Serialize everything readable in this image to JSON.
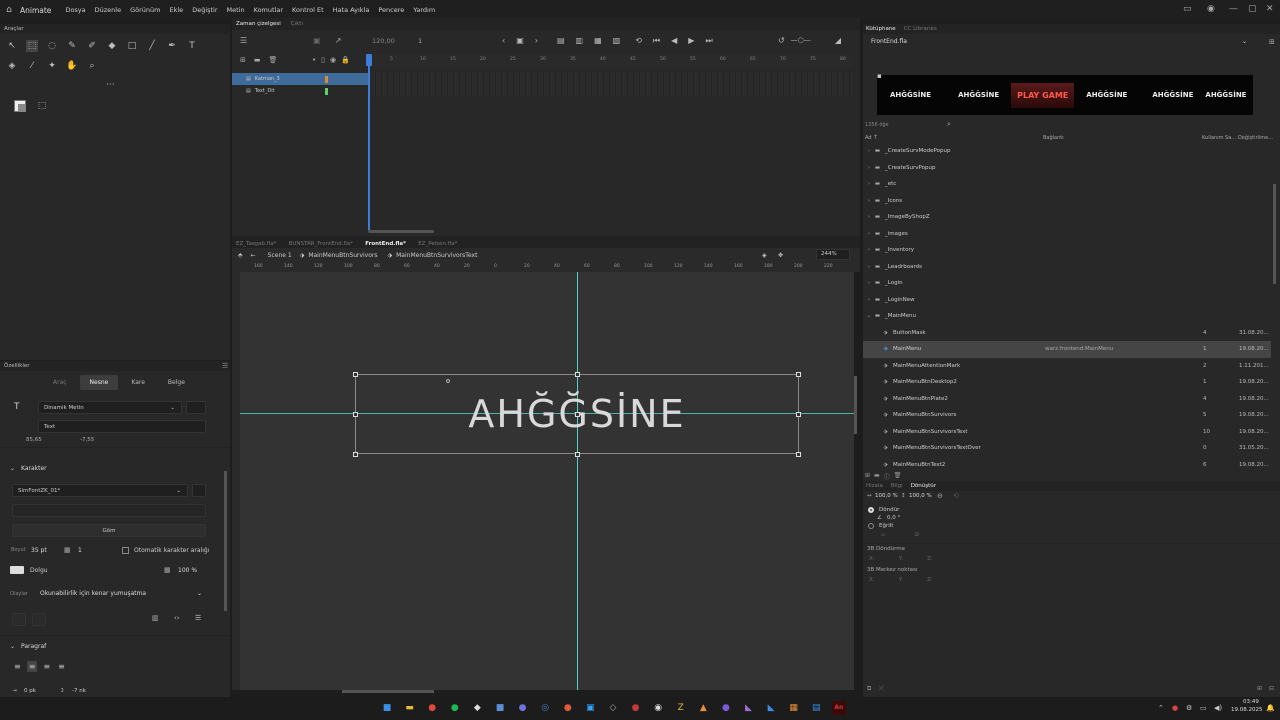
{
  "menubar": {
    "app_name": "Animate",
    "items": [
      "Dosya",
      "Düzenle",
      "Görünüm",
      "Ekle",
      "Değiştir",
      "Metin",
      "Komutlar",
      "Kontrol Et",
      "Hata Ayıkla",
      "Pencere",
      "Yardım"
    ]
  },
  "tools_panel": {
    "title": "Araçlar"
  },
  "timeline": {
    "tabs": [
      "Zaman çizelgesi",
      "Çıktı"
    ],
    "fps": "120,00",
    "frame": "1",
    "layers": [
      {
        "name": "Katman_3",
        "color": "#e0873a"
      },
      {
        "name": "Text_Dit",
        "color": "#5fd35f"
      }
    ],
    "ruler_ticks": [
      "5",
      "10",
      "15",
      "20",
      "25",
      "30",
      "35",
      "40",
      "45",
      "50",
      "55",
      "60",
      "65",
      "70",
      "75",
      "80"
    ]
  },
  "document_tabs": [
    "EZ_Tasgab.fla*",
    "BUNSTAR_FrontEnd.fla*",
    "FrontEnd.fla*",
    "EZ_Pelsen.fla*"
  ],
  "breadcrumb": {
    "scene": "Scene 1",
    "symbol1": "MainMenuBtnSurvivors",
    "symbol2": "MainMenuBtnSurvivorsText",
    "zoom": "244%"
  },
  "stage": {
    "ruler_ticks": [
      "160",
      "140",
      "120",
      "100",
      "80",
      "60",
      "40",
      "20",
      "0",
      "20",
      "40",
      "60",
      "80",
      "100",
      "120",
      "140",
      "160",
      "180",
      "200",
      "220"
    ],
    "text": "AHĞĞSİNE"
  },
  "properties": {
    "title": "Özellikler",
    "tabs": [
      "Araç",
      "Nesne",
      "Kare",
      "Belge"
    ],
    "text_type": "Dinamik Metin",
    "instance_name": "Text",
    "x": "85,65",
    "y": "-7,55",
    "character_section": "Karakter",
    "font": "SimFontZK_01*",
    "embed_button": "Göm",
    "size_label": "Boyut",
    "size_value": "35 pt",
    "letter_spacing": "1",
    "auto_kern_label": "Otomatik karakter aralığı",
    "fill_label": "Dolgu",
    "fill_percent": "100 %",
    "options_label": "Olaylar",
    "antialias": "Okunabilirlik için kenar yumuşatma",
    "paragraph_section": "Paragraf",
    "indent": "0 pk",
    "line_spacing": "-7 nk"
  },
  "library": {
    "tabs": [
      "Kütüphane",
      "CC Libraries"
    ],
    "file": "FrontEnd.fla",
    "preview_items": [
      "AHĞĞSİNE",
      "AHĞĞSİNE",
      "PLAY GAME",
      "AHĞĞSİNE",
      "AHĞĞSİNE",
      "AHĞĞSİNE"
    ],
    "count": "1356 öğe",
    "columns": {
      "name": "Ad",
      "linkage": "Bağlantı",
      "uses": "Kullanım Sa...",
      "modified": "Değiştirilme..."
    },
    "items": [
      {
        "name": "_CreateSurvModePopup",
        "type": "folder",
        "uses": "",
        "mod": "",
        "link": ""
      },
      {
        "name": "_CreateSurvPopup",
        "type": "folder",
        "uses": "",
        "mod": "",
        "link": ""
      },
      {
        "name": "_etc",
        "type": "folder",
        "uses": "",
        "mod": "",
        "link": ""
      },
      {
        "name": "_Icons",
        "type": "folder",
        "uses": "",
        "mod": "",
        "link": ""
      },
      {
        "name": "_ImageByShopZ",
        "type": "folder",
        "uses": "",
        "mod": "",
        "link": ""
      },
      {
        "name": "_images",
        "type": "folder",
        "uses": "",
        "mod": "",
        "link": ""
      },
      {
        "name": "_Inventory",
        "type": "folder",
        "uses": "",
        "mod": "",
        "link": ""
      },
      {
        "name": "_Leadrboards",
        "type": "folder",
        "uses": "",
        "mod": "",
        "link": ""
      },
      {
        "name": "_Login",
        "type": "folder",
        "uses": "",
        "mod": "",
        "link": ""
      },
      {
        "name": "_LoginNew",
        "type": "folder",
        "uses": "",
        "mod": "",
        "link": ""
      },
      {
        "name": "_MainMenu",
        "type": "folder-open",
        "uses": "",
        "mod": "",
        "link": ""
      },
      {
        "name": "ButtonMask",
        "type": "symbol",
        "uses": "4",
        "mod": "31.08.20...",
        "link": ""
      },
      {
        "name": "MainMenu",
        "type": "symbol",
        "uses": "1",
        "mod": "19.08.20...",
        "link": "warz.frontend.MainMenu",
        "selected": true
      },
      {
        "name": "MainMenuAttentionMark",
        "type": "symbol",
        "uses": "2",
        "mod": "1.11.201...",
        "link": ""
      },
      {
        "name": "MainMenuBtnDesktop2",
        "type": "symbol",
        "uses": "1",
        "mod": "19.08.20...",
        "link": ""
      },
      {
        "name": "MainMenuBtnPlate2",
        "type": "symbol",
        "uses": "4",
        "mod": "19.08.20...",
        "link": ""
      },
      {
        "name": "MainMenuBtnSurvivors",
        "type": "symbol",
        "uses": "5",
        "mod": "19.08.20...",
        "link": ""
      },
      {
        "name": "MainMenuBtnSurvivorsText",
        "type": "symbol",
        "uses": "10",
        "mod": "19.08.20...",
        "link": ""
      },
      {
        "name": "MainMenuBtnSurvivorsTextOver",
        "type": "symbol",
        "uses": "0",
        "mod": "31.05.20...",
        "link": ""
      },
      {
        "name": "MainMenuBtnText2",
        "type": "symbol",
        "uses": "6",
        "mod": "19.08.20...",
        "link": ""
      }
    ]
  },
  "transform": {
    "tabs": [
      "Hizala",
      "Bilgi",
      "Dönüştür"
    ],
    "scale_w": "100,0 %",
    "scale_h": "100,0 %",
    "rotate_label": "Döndür",
    "rotate_value": "0,0 °",
    "skew_label": "Eğrilt",
    "rotation3d_label": "3B Döndürme",
    "center3d_label": "3B Merkez noktası",
    "x": "X:",
    "y": "Y:",
    "z": "Z:"
  },
  "taskbar": {
    "time": "03:49",
    "date": "19.08.2025",
    "icons": [
      {
        "name": "windows-start-icon",
        "color": "#3a8ee6",
        "glyph": "■"
      },
      {
        "name": "file-explorer-icon",
        "color": "#e8b83a",
        "glyph": "▬"
      },
      {
        "name": "chrome-icon",
        "color": "#e04a3a",
        "glyph": "●"
      },
      {
        "name": "spotify-icon",
        "color": "#1db954",
        "glyph": "●"
      },
      {
        "name": "epic-icon",
        "color": "#dddddd",
        "glyph": "◆"
      },
      {
        "name": "app-icon",
        "color": "#5b8dd6",
        "glyph": "■"
      },
      {
        "name": "discord-icon",
        "color": "#6c72e0",
        "glyph": "●"
      },
      {
        "name": "steam-icon",
        "color": "#4a7fbf",
        "glyph": "◎"
      },
      {
        "name": "app-icon-2",
        "color": "#e05a3a",
        "glyph": "●"
      },
      {
        "name": "photoshop-icon",
        "color": "#31a8ff",
        "glyph": "▣"
      },
      {
        "name": "app-icon-3",
        "color": "#aaaaaa",
        "glyph": "◇"
      },
      {
        "name": "app-icon-4",
        "color": "#c23a3a",
        "glyph": "●"
      },
      {
        "name": "obs-icon",
        "color": "#dddddd",
        "glyph": "◉"
      },
      {
        "name": "zoom-icon",
        "color": "#e8b83a",
        "glyph": "Z"
      },
      {
        "name": "app-icon-5",
        "color": "#e8903a",
        "glyph": "▲"
      },
      {
        "name": "app-icon-6",
        "color": "#7a5ad6",
        "glyph": "●"
      },
      {
        "name": "visual-studio-icon",
        "color": "#a06ad6",
        "glyph": "◣"
      },
      {
        "name": "vscode-icon",
        "color": "#3a8ee6",
        "glyph": "◣"
      },
      {
        "name": "app-icon-7",
        "color": "#e8903a",
        "glyph": "▦"
      },
      {
        "name": "app-icon-8",
        "color": "#3a8ee6",
        "glyph": "▤"
      },
      {
        "name": "animate-icon",
        "color": "#cc3a3a",
        "glyph": "An"
      }
    ]
  }
}
